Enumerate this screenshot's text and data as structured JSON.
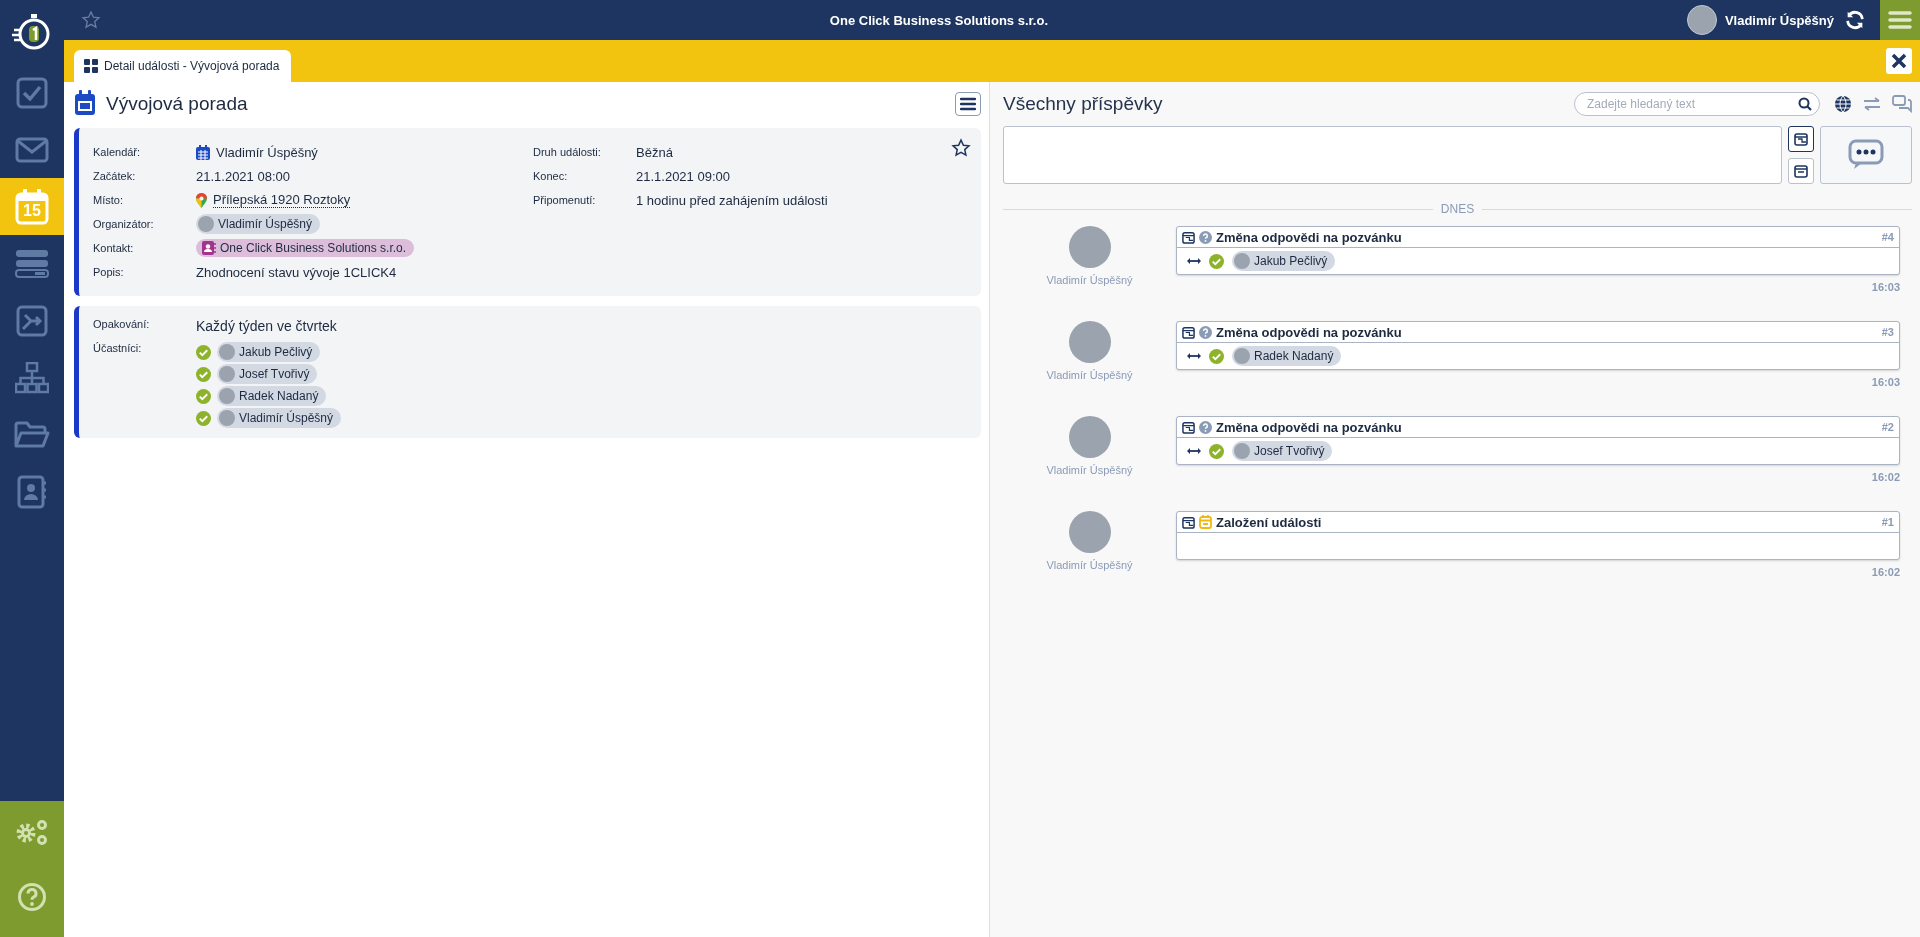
{
  "topbar": {
    "company": "One Click Business Solutions s.r.o.",
    "user": "Vladimír Úspěšný"
  },
  "sidebar": {
    "items": [
      {
        "kind": "tasks",
        "selected": false
      },
      {
        "kind": "mail",
        "selected": false
      },
      {
        "kind": "calendar",
        "selected": true,
        "badge": "15"
      },
      {
        "kind": "servers",
        "selected": false
      },
      {
        "kind": "flow",
        "selected": false
      },
      {
        "kind": "orgchart",
        "selected": false
      },
      {
        "kind": "folder",
        "selected": false
      },
      {
        "kind": "contacts",
        "selected": false
      }
    ],
    "bottom": [
      {
        "kind": "settings"
      },
      {
        "kind": "help"
      }
    ]
  },
  "tabs": [
    {
      "label": "Detail události - Vývojová porada",
      "selected": true
    }
  ],
  "event": {
    "title": "Vývojová porada",
    "left": [
      {
        "label": "Kalendář:",
        "kind": "calendar",
        "value": "Vladimír Úspěšný"
      },
      {
        "label": "Začátek:",
        "kind": "text",
        "value": "21.1.2021 08:00"
      },
      {
        "label": "Místo:",
        "kind": "place",
        "value": "Přílepská 1920 Roztoky"
      },
      {
        "label": "Organizátor:",
        "kind": "person",
        "value": "Vladimír Úspěšný"
      },
      {
        "label": "Kontakt:",
        "kind": "contact",
        "value": "One Click Business Solutions s.r.o."
      },
      {
        "label": "Popis:",
        "kind": "text",
        "value": "Zhodnocení stavu vývoje 1CLICK4"
      }
    ],
    "right": [
      {
        "label": "Druh události:",
        "kind": "text",
        "value": "Běžná"
      },
      {
        "label": "Konec:",
        "kind": "text",
        "value": "21.1.2021 09:00"
      },
      {
        "label": "Připomenutí:",
        "kind": "text",
        "value": "1 hodinu před zahájením události"
      }
    ],
    "favorite": false,
    "recurrence": {
      "label": "Opakování:",
      "value": "Každý týden ve čtvrtek"
    },
    "participants": {
      "label": "Účastníci:",
      "items": [
        {
          "name": "Jakub Pečlivý",
          "accepted": true
        },
        {
          "name": "Josef Tvořivý",
          "accepted": true
        },
        {
          "name": "Radek Nadaný",
          "accepted": true
        },
        {
          "name": "Vladimír Úspěšný",
          "accepted": true
        }
      ]
    }
  },
  "feed": {
    "title": "Všechny příspěvky",
    "search": {
      "placeholder": "Zadejte hledaný text"
    },
    "divider": "DNES",
    "posts": [
      {
        "kind": "response",
        "author": "Vladimír Úspěšný",
        "title": "Změna odpovědi na pozvánku",
        "number": "#4",
        "participant": "Jakub Pečlivý",
        "accepted": true,
        "time": "16:03"
      },
      {
        "kind": "response",
        "author": "Vladimír Úspěšný",
        "title": "Změna odpovědi na pozvánku",
        "number": "#3",
        "participant": "Radek Nadaný",
        "accepted": true,
        "time": "16:03"
      },
      {
        "kind": "response",
        "author": "Vladimír Úspěšný",
        "title": "Změna odpovědi na pozvánku",
        "number": "#2",
        "participant": "Josef Tvořivý",
        "accepted": true,
        "time": "16:02"
      },
      {
        "kind": "created",
        "author": "Vladimír Úspěšný",
        "title": "Založení události",
        "number": "#1",
        "time": "16:02"
      }
    ]
  }
}
